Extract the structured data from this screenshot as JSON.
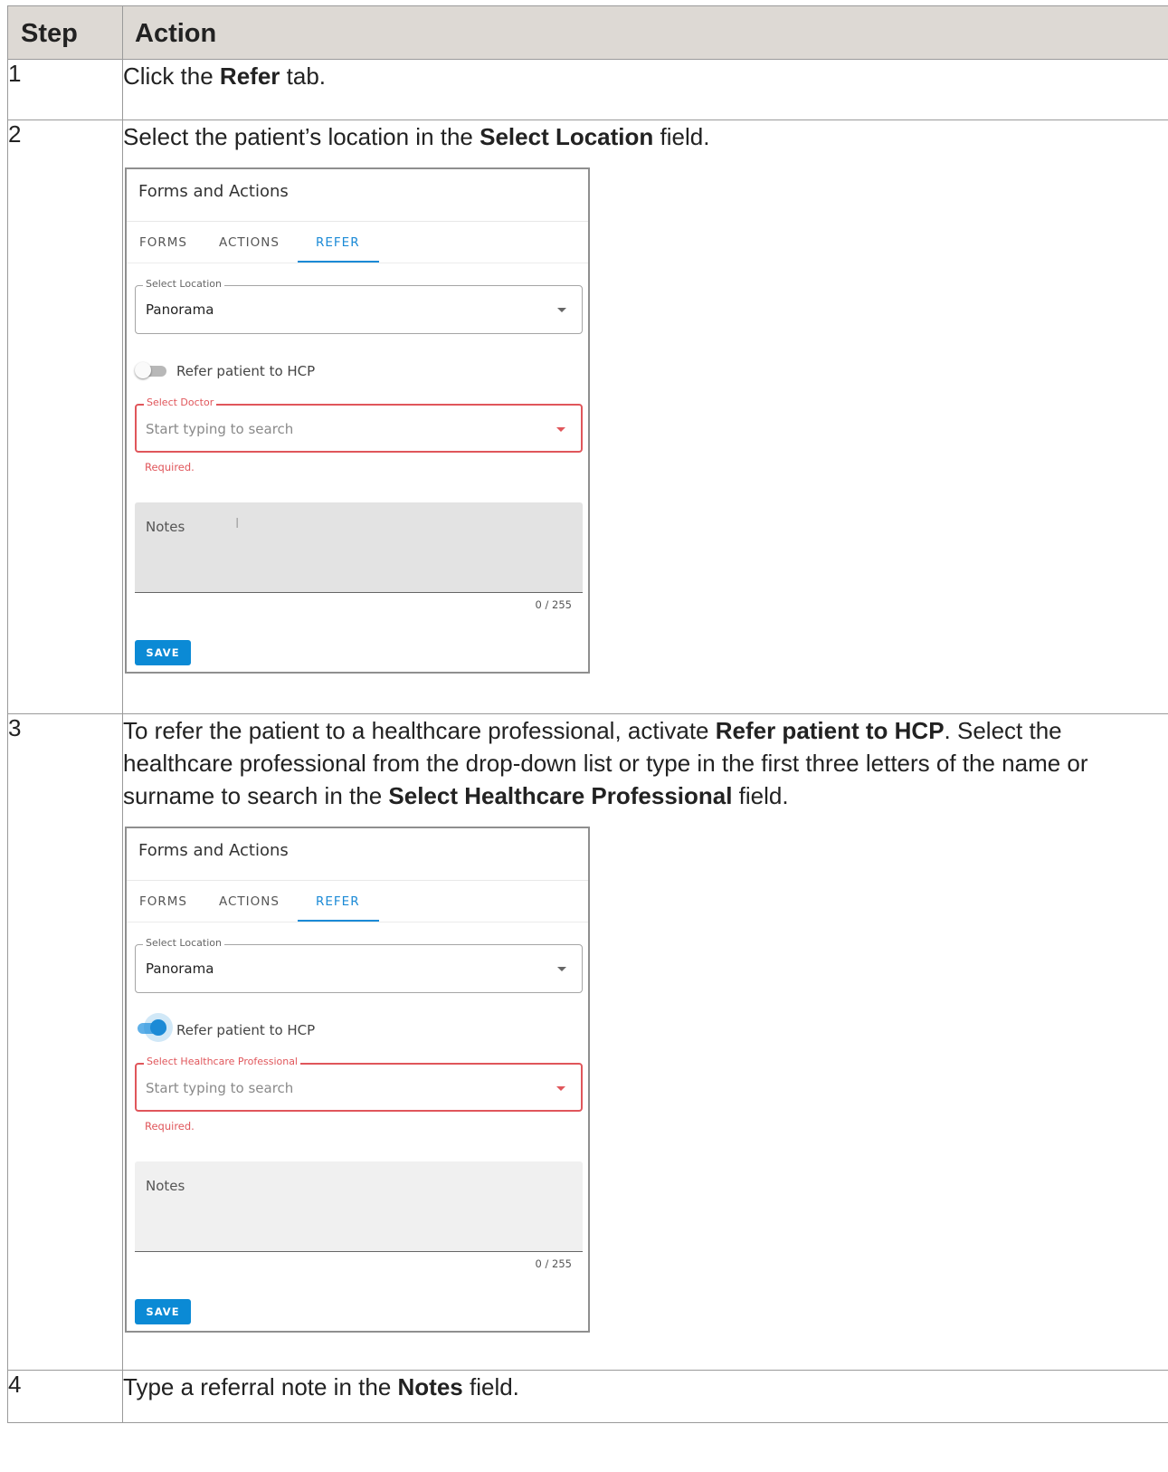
{
  "header": {
    "step": "Step",
    "action": "Action"
  },
  "rows": [
    {
      "num": "1",
      "pre": "Click the ",
      "bold": "Refer",
      "post": " tab."
    },
    {
      "num": "2",
      "pre": "Select the patient’s location in the ",
      "bold": "Select Location",
      "post": " field."
    },
    {
      "num": "3",
      "pre": "To refer the patient to a healthcare professional, activate ",
      "bold": "Refer patient to HCP",
      "mid": ". Select the healthcare professional from the drop-down list or type in the first three letters of the name or surname to search in the ",
      "bold2": "Select Healthcare Professional",
      "post": " field."
    },
    {
      "num": "4",
      "pre": "Type a referral note in the ",
      "bold": "Notes",
      "post": " field."
    }
  ],
  "panel1": {
    "title": "Forms and Actions",
    "tabs": [
      "FORMS",
      "ACTIONS",
      "REFER"
    ],
    "active_tab": "REFER",
    "location_label": "Select Location",
    "location_value": "Panorama",
    "toggle_label": "Refer patient to HCP",
    "toggle_on": false,
    "select_label": "Select Doctor",
    "select_placeholder": "Start typing to search",
    "required": "Required.",
    "notes_label": "Notes",
    "counter": "0 / 255",
    "save": "SAVE"
  },
  "panel2": {
    "title": "Forms and Actions",
    "tabs": [
      "FORMS",
      "ACTIONS",
      "REFER"
    ],
    "active_tab": "REFER",
    "location_label": "Select Location",
    "location_value": "Panorama",
    "toggle_label": "Refer patient to HCP",
    "toggle_on": true,
    "select_label": "Select Healthcare Professional",
    "select_placeholder": "Start typing to search",
    "required": "Required.",
    "notes_label": "Notes",
    "counter": "0 / 255",
    "save": "SAVE"
  },
  "colors": {
    "header_bg": "#ddd9d4",
    "accent": "#1b8ad6",
    "error": "#e0565b",
    "save_bg": "#0b8ad5"
  }
}
